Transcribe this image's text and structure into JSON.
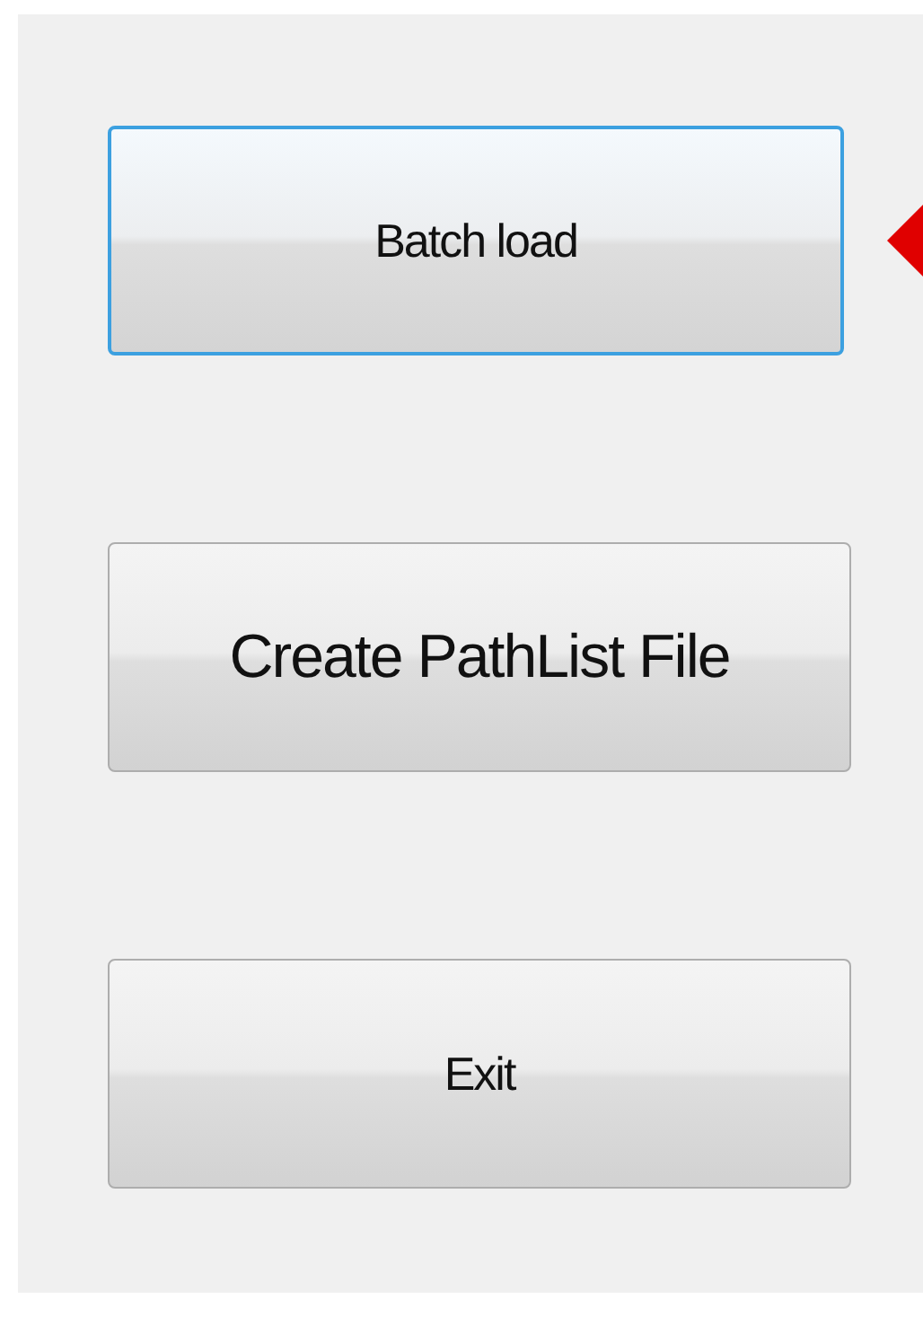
{
  "buttons": [
    {
      "label": "Batch load",
      "focused": true
    },
    {
      "label": "Create PathList File",
      "focused": false
    },
    {
      "label": "Exit",
      "focused": false
    }
  ]
}
